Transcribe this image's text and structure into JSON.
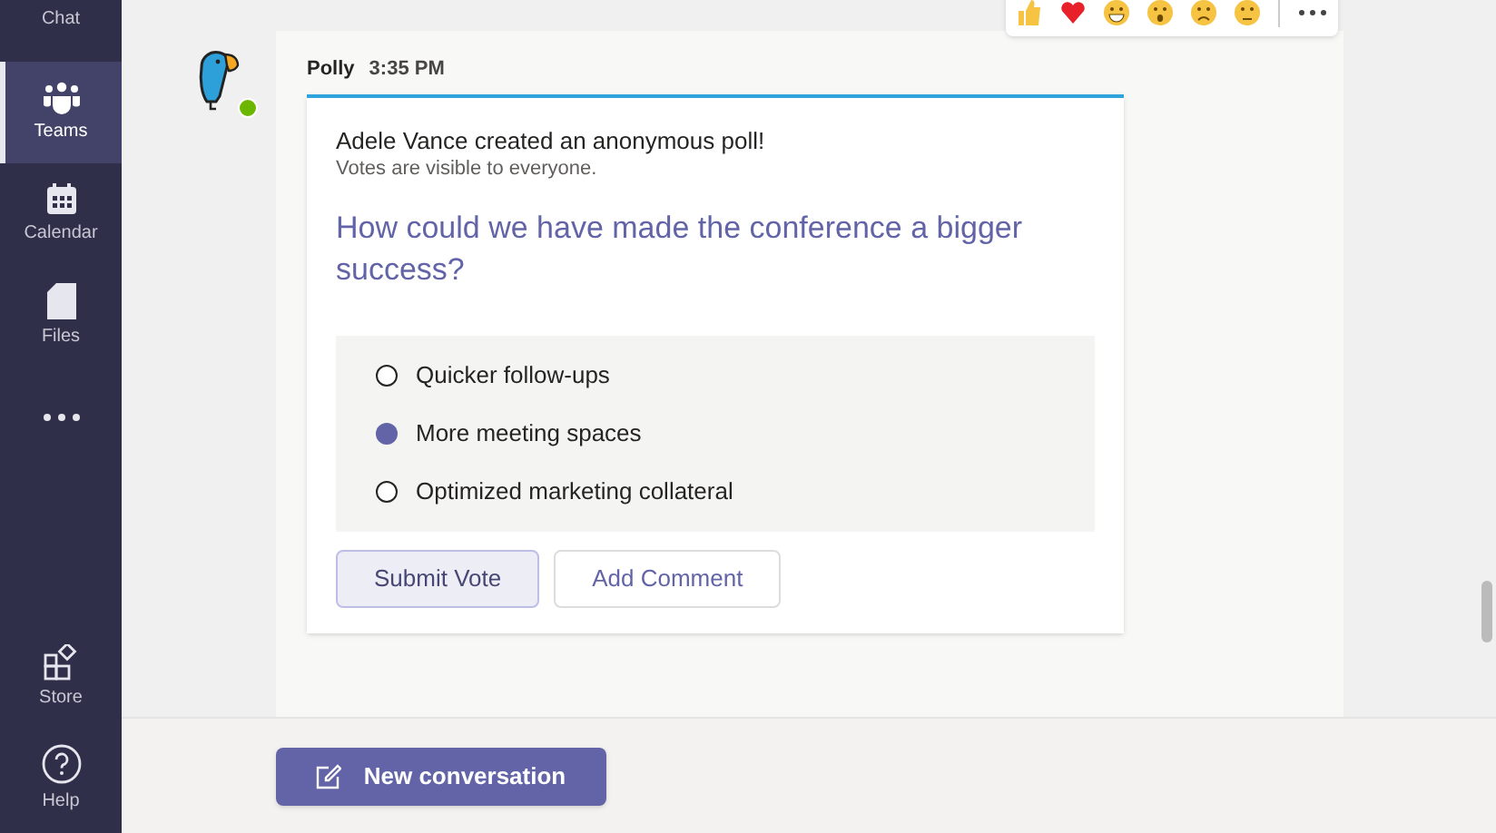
{
  "sidebar": {
    "items": [
      {
        "label": "Chat",
        "selected": false
      },
      {
        "label": "Teams",
        "selected": true
      },
      {
        "label": "Calendar",
        "selected": false
      },
      {
        "label": "Files",
        "selected": false
      },
      {
        "selected": false
      }
    ],
    "bottom_items": [
      {
        "label": "Store",
        "selected": false
      },
      {
        "label": "Help",
        "selected": false
      }
    ]
  },
  "message": {
    "author": "Polly",
    "time": "3:35 PM",
    "online": true,
    "poll": {
      "intro": "Adele Vance created an anonymous poll!",
      "note": "Votes are visible to everyone.",
      "question": "How could we have made the conference a bigger success?",
      "options": [
        {
          "label": "Quicker follow-ups",
          "selected": false
        },
        {
          "label": "More meeting spaces",
          "selected": true
        },
        {
          "label": "Optimized marketing collateral",
          "selected": false
        }
      ],
      "buttons": [
        {
          "label": "Submit Vote",
          "kind": "hovered"
        },
        {
          "label": "Add Comment",
          "kind": "plain"
        }
      ]
    }
  },
  "compose": {
    "button": "New conversation"
  }
}
